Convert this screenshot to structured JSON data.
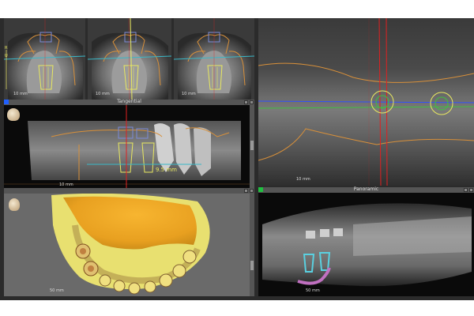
{
  "views": {
    "crosssection_1": {
      "scale_label": "10 mm",
      "side_label": "R",
      "side_label_2": "U"
    },
    "crosssection_2": {
      "scale_label": "10 mm"
    },
    "crosssection_3": {
      "scale_label": "10 mm"
    },
    "tangential": {
      "title": "Tangential",
      "scale_label": "10 mm",
      "measure_label": "9.5 mm"
    },
    "axial": {
      "scale_label": "10 mm"
    },
    "render3d": {
      "scale_label": "50 mm"
    },
    "panoramic": {
      "title": "Panoramic",
      "scale_label": "50 mm"
    }
  },
  "icons": {
    "head_orientation_top": "head-orientation-icon",
    "head_orientation_bottom": "head-orientation-icon"
  },
  "colors": {
    "implant_yellow": "#e8e860",
    "nerve_purple": "#c070c0",
    "contour_orange": "#d8903a",
    "axis_cyan": "#39b7c7",
    "axis_green": "#40c040",
    "axis_blue": "#3050ff",
    "axis_red": "#e02020",
    "active_indicator_blue": "#2060ff",
    "active_indicator_green": "#20c040"
  }
}
